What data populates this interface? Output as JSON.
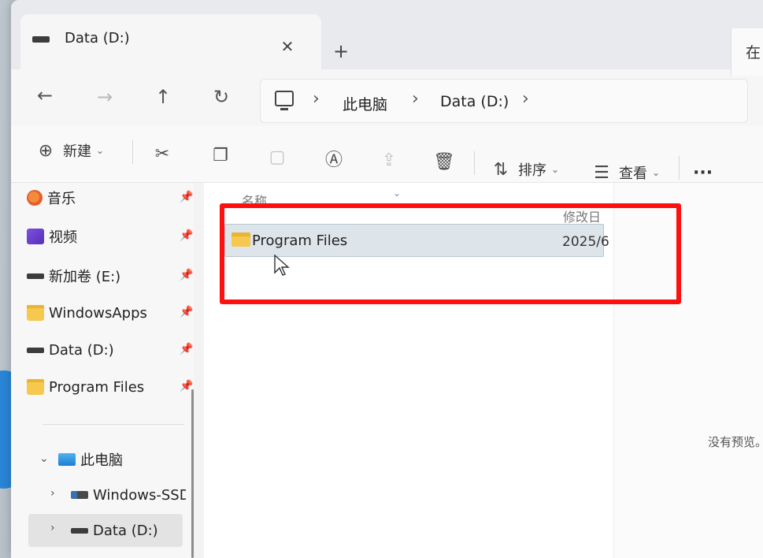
{
  "window": {
    "tab_title": "Data (D:)",
    "tab_close": "✕",
    "tab_add": "+"
  },
  "nav": {
    "back": "←",
    "forward": "→",
    "up": "↑",
    "refresh": "↻",
    "breadcrumbs": [
      "此电脑",
      "Data (D:)"
    ],
    "search_stub": "在"
  },
  "commands": {
    "new_label": "新建",
    "sort_label": "排序",
    "view_label": "查看",
    "more_label": "···"
  },
  "sidebar": {
    "items": [
      {
        "label": "音乐",
        "icon": "music-icon",
        "pinned": true
      },
      {
        "label": "视频",
        "icon": "video-icon",
        "pinned": true
      },
      {
        "label": "新加卷 (E:)",
        "icon": "drive-icon",
        "pinned": true
      },
      {
        "label": "WindowsApps",
        "icon": "folder-icon",
        "pinned": true
      },
      {
        "label": "Data (D:)",
        "icon": "drive-icon",
        "pinned": true
      },
      {
        "label": "Program Files",
        "icon": "folder-icon",
        "pinned": true
      }
    ],
    "this_pc": "此电脑",
    "drives": [
      {
        "label": "Windows-SSD",
        "icon": "ssd-icon"
      },
      {
        "label": "Data (D:)",
        "icon": "drive-icon",
        "selected": true
      }
    ]
  },
  "content": {
    "columns": {
      "name": "名称",
      "modified": "修改日"
    },
    "files": [
      {
        "name": "Program Files",
        "modified": "2025/6",
        "icon": "folder-icon"
      }
    ],
    "preview_empty": "没有预览。"
  },
  "colors": {
    "highlight": "#ff1010",
    "selection": "#dde4ea"
  }
}
